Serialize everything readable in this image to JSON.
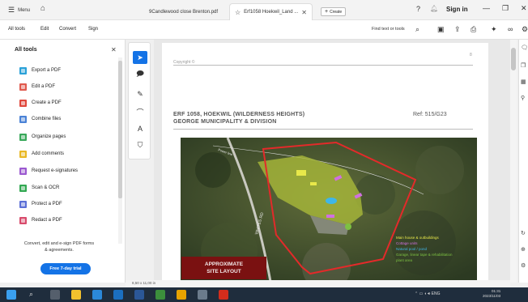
{
  "titlebar": {
    "menu_label": "Menu",
    "tabs": [
      {
        "label": "9Candlewood close Brenton.pdf"
      },
      {
        "label": "Erf1058 Hoekwil_Land ..."
      }
    ],
    "create_label": "Create",
    "signin_label": "Sign in"
  },
  "toolbar": {
    "items": [
      "All tools",
      "Edit",
      "Convert",
      "Sign"
    ],
    "find_label": "Find text or tools"
  },
  "left_panel": {
    "title": "All tools",
    "tools": [
      {
        "label": "Export a PDF",
        "color": "#2aa1d8"
      },
      {
        "label": "Edit a PDF",
        "color": "#e05a4e"
      },
      {
        "label": "Create a PDF",
        "color": "#e0473c"
      },
      {
        "label": "Combine files",
        "color": "#4a82d6"
      },
      {
        "label": "Organize pages",
        "color": "#39a85a"
      },
      {
        "label": "Add comments",
        "color": "#e9b824"
      },
      {
        "label": "Request e-signatures",
        "color": "#9b59d0"
      },
      {
        "label": "Scan & OCR",
        "color": "#32a852"
      },
      {
        "label": "Protect a PDF",
        "color": "#5b6fd6"
      },
      {
        "label": "Redact a PDF",
        "color": "#d84b6c"
      }
    ],
    "promo_text": "Convert, edit and e-sign PDF forms & agreements.",
    "trial_button": "Free 7-day trial"
  },
  "document": {
    "copyright": "Copyright ©",
    "page_marker": "8",
    "title_line1": "ERF 1058, HOEKWIL (WILDERNESS HEIGHTS)",
    "title_line2": "GEORGE MUNICIPALITY & DIVISION",
    "ref": "Ref: 515/G23",
    "map_label_line1": "APPROXIMATE",
    "map_label_line2": "SITE LAYOUT",
    "road_label": "WHITES RD",
    "power_line_label": "Power line",
    "legend": [
      {
        "text": "Main house & outbuildings",
        "color": "#e8e84a"
      },
      {
        "text": "Cottage units",
        "color": "#d070e0"
      },
      {
        "text": "Natural pool / pond",
        "color": "#3fb6e8"
      },
      {
        "text": "Garage, linear tape & rehabilitation",
        "color": "#7dc142"
      },
      {
        "text": "plant area",
        "color": "#7dc142"
      }
    ]
  },
  "statusbar": {
    "page_size": "8,50 x 11,00 in"
  },
  "taskbar": {
    "tray_lang": "ENG",
    "time": "01:31",
    "date": "2023/11/03"
  }
}
